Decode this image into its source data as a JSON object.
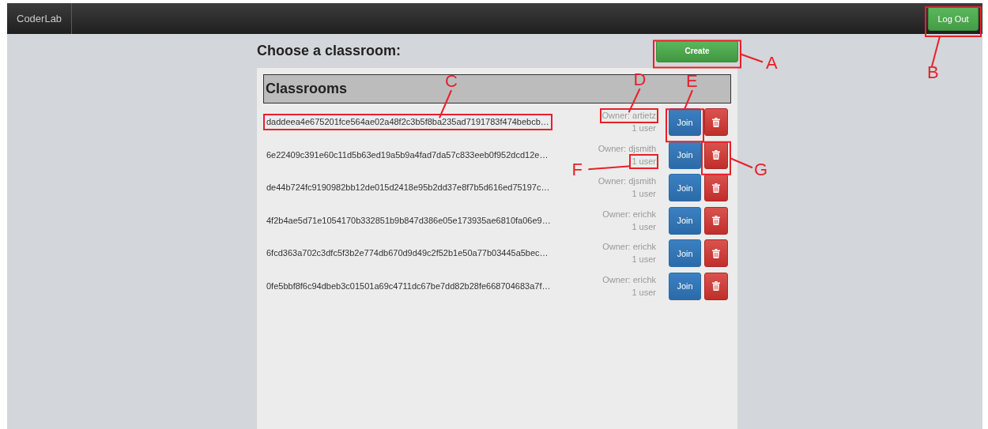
{
  "navbar": {
    "brand": "CoderLab",
    "logout_button": "Log Out"
  },
  "heading": "Choose a classroom:",
  "create_button": "Create",
  "panel": {
    "title": "Classrooms"
  },
  "classrooms": [
    {
      "id": "daddeea4e675201fce564ae02a48f2c3b5f8ba235ad7191783f474bebcb…",
      "owner": "Owner: artietz",
      "users": "1 user",
      "join": "Join"
    },
    {
      "id": "6e22409c391e60c11d5b63ed19a5b9a4fad7da57c833eeb0f952dcd12e…",
      "owner": "Owner: djsmith",
      "users": "1 user",
      "join": "Join"
    },
    {
      "id": "de44b724fc9190982bb12de015d2418e95b2dd37e8f7b5d616ed75197c…",
      "owner": "Owner: djsmith",
      "users": "1 user",
      "join": "Join"
    },
    {
      "id": "4f2b4ae5d71e1054170b332851b9b847d386e05e173935ae6810fa06e9…",
      "owner": "Owner: erichk",
      "users": "1 user",
      "join": "Join"
    },
    {
      "id": "6fcd363a702c3dfc5f3b2e774db670d9d49c2f52b1e50a77b03445a5bec…",
      "owner": "Owner: erichk",
      "users": "1 user",
      "join": "Join"
    },
    {
      "id": "0fe5bbf8f6c94dbeb3c01501a69c4711dc67be7dd82b28fe668704683a7f…",
      "owner": "Owner: erichk",
      "users": "1 user",
      "join": "Join"
    }
  ],
  "annotations": [
    {
      "label": "A"
    },
    {
      "label": "B"
    },
    {
      "label": "C"
    },
    {
      "label": "D"
    },
    {
      "label": "E"
    },
    {
      "label": "F"
    },
    {
      "label": "G"
    }
  ]
}
